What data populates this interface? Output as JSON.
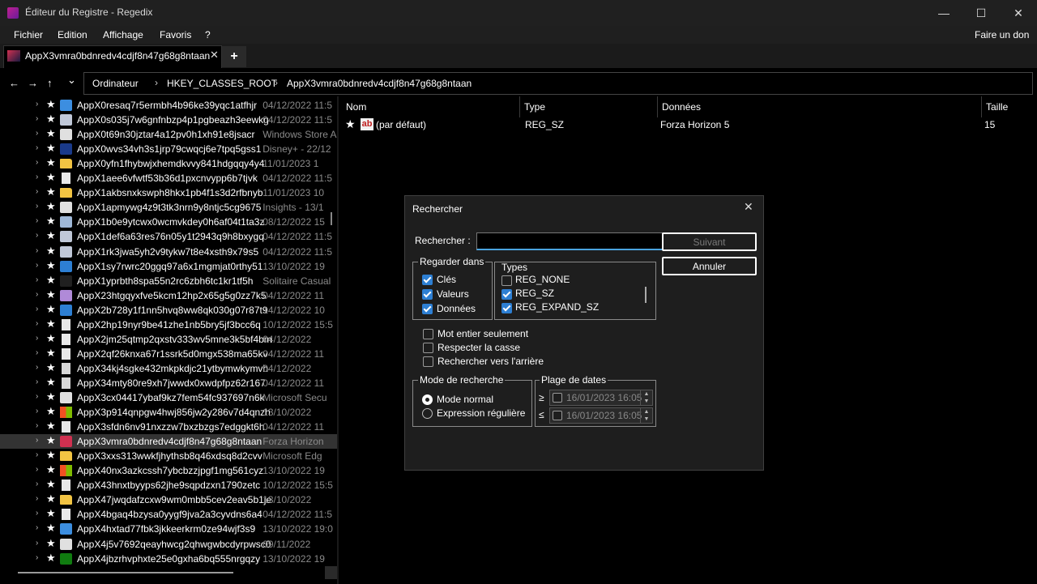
{
  "window": {
    "title": "Éditeur du Registre - Regedix",
    "controls": {
      "minimize": "—",
      "maximize": "☐",
      "close": "✕"
    }
  },
  "menu": {
    "items": [
      "Fichier",
      "Edition",
      "Affichage",
      "Favoris",
      "?"
    ],
    "right": "Faire un don"
  },
  "tabs": {
    "active_label": "AppX3vmra0bdnredv4cdjf8n47g68g8ntaan",
    "close": "✕",
    "add": "+"
  },
  "nav": {
    "back": "←",
    "forward": "→",
    "up": "↑",
    "history": "⌄",
    "breadcrumbs": [
      "Ordinateur",
      "HKEY_CLASSES_ROOT",
      "AppX3vmra0bdnredv4cdjf8n47g68g8ntaan"
    ],
    "separator": "›"
  },
  "tree": {
    "chevron": "›",
    "star": "★",
    "rows": [
      {
        "name": "AppX0resaq7r5ermbh4b96ke39yqc1atfhjr",
        "info": "04/12/2022 11:5",
        "icon": "people-icon",
        "color": "#3c8ee0"
      },
      {
        "name": "AppX0s035j7w6gnfnbzp4p1pgbeazh3eewkg",
        "info": "04/12/2022 11:5",
        "icon": "app-icon",
        "color": "#c0c8d8"
      },
      {
        "name": "AppX0t69n30jztar4a12pv0h1xh91e8jsacr",
        "info": "Windows Store A",
        "icon": "store-icon",
        "color": "#e0e0e0"
      },
      {
        "name": "AppX0wvs34vh3s1jrp79cwqcj6e7tpq5gss1",
        "info": "Disney+ - 22/12",
        "icon": "disney-icon",
        "color": "#1a3a8a"
      },
      {
        "name": "AppX0yfn1fhybwjxhemdkvvy841hdgqqy4y4",
        "info": "11/01/2023 1",
        "icon": "folder-icon",
        "color": "#f2c443"
      },
      {
        "name": "AppX1aee6vfwtf53b36d1pxcnvypp6b7tjvk",
        "info": "04/12/2022 11:5",
        "icon": "file-icon",
        "color": "#e8e8e8"
      },
      {
        "name": "AppX1akbsnxkswph8hkx1pb4f1s3d2rfbnyb",
        "info": "11/01/2023 10",
        "icon": "folder-icon",
        "color": "#f2c443"
      },
      {
        "name": "AppX1apmywg4z9t3tk3nrn9y8ntjc5cg9675",
        "info": "Insights - 13/1",
        "icon": "window-icon",
        "color": "#e0e0e0"
      },
      {
        "name": "AppX1b0e9ytcwx0wcmvkdey0h6af04t1ta3z",
        "info": "08/12/2022 15",
        "icon": "image-icon",
        "color": "#9fb8d8"
      },
      {
        "name": "AppX1def6a63res76n05y1t2943q9h8bxygq",
        "info": "04/12/2022 11:5",
        "icon": "app-icon",
        "color": "#c0c8d8"
      },
      {
        "name": "AppX1rk3jwa5yh2v9tykw7t8e4xsth9x79s5",
        "info": "04/12/2022 11:5",
        "icon": "app-icon",
        "color": "#c0c8d8"
      },
      {
        "name": "AppX1sy7rwrc20ggq97a6x1mgmjat0rthy51",
        "info": "13/10/2022 19",
        "icon": "shield-icon",
        "color": "#2d7fd3"
      },
      {
        "name": "AppX1yprbth8spa55n2rc6zbh6tc1kr1tf5h",
        "info": "Solitaire Casual",
        "icon": "cards-icon",
        "color": "#202020"
      },
      {
        "name": "AppX23htgqyxfve5kcm12hp2x65g5g0zz7k5",
        "info": "04/12/2022 11",
        "icon": "app-icon",
        "color": "#b08ad8"
      },
      {
        "name": "AppX2b728y1f1nn5hvq8ww8qk030g07r87t9",
        "info": "14/12/2022 10",
        "icon": "gear-icon",
        "color": "#2d7fd3"
      },
      {
        "name": "AppX2hp19nyr9be41zhe1nb5bry5jf3bcc6q",
        "info": "10/12/2022 15:5",
        "icon": "doc-icon",
        "color": "#e8e8e8"
      },
      {
        "name": "AppX2jm25qtmp2qxstv333wv5mne3k5bf4bm",
        "info": "04/12/2022",
        "icon": "file-icon",
        "color": "#e8e8e8"
      },
      {
        "name": "AppX2qf26knxa67r1ssrk5d0mgx538ma65kv",
        "info": "04/12/2022 11",
        "icon": "file-icon",
        "color": "#e8e8e8"
      },
      {
        "name": "AppX34kj4sgke432mkpkdjc21ytbymwkymvh",
        "info": "04/12/2022",
        "icon": "file-icon",
        "color": "#d8d8d8"
      },
      {
        "name": "AppX34mty80re9xh7jwwdx0xwdpfpz62r167",
        "info": "04/12/2022 11",
        "icon": "file-icon",
        "color": "#d8d8d8"
      },
      {
        "name": "AppX3cx04417ybaf9kz7fem54fc937697n6k",
        "info": "Microsoft Secu",
        "icon": "security-icon",
        "color": "#e0e0e0"
      },
      {
        "name": "AppX3p914qnpgw4hwj856jw2y286v7d4qnzh",
        "info": "13/10/2022",
        "icon": "windows-icon",
        "color": "#f25022"
      },
      {
        "name": "AppX3sfdn6nv91nxzzw7bxzbzgs7edggkt6h",
        "info": "04/12/2022 11",
        "icon": "file-icon",
        "color": "#e8e8e8"
      },
      {
        "name": "AppX3vmra0bdnredv4cdjf8n47g68g8ntaan",
        "info": "Forza Horizon",
        "icon": "forza-icon",
        "color": "#d03050",
        "selected": true
      },
      {
        "name": "AppX3xxs313wwkfjhythsb8q46xdsq8d2cvv",
        "info": "Microsoft Edg",
        "icon": "folder-icon",
        "color": "#f2c443"
      },
      {
        "name": "AppX40nx3azkcssh7ybcbzzjpgf1mg561cyz",
        "info": "13/10/2022 19",
        "icon": "windows-icon",
        "color": "#f25022"
      },
      {
        "name": "AppX43hnxtbyyps62jhe9sqpdzxn1790zetc",
        "info": "10/12/2022 15:5",
        "icon": "doc-icon",
        "color": "#e8e8e8"
      },
      {
        "name": "AppX47jwqdafzcxw9wm0mbb5cev2eav5b1je",
        "info": "13/10/2022",
        "icon": "folder-icon",
        "color": "#f2c443"
      },
      {
        "name": "AppX4bgaq4bzysa0yygf9jva2a3cyvdns6a4",
        "info": "04/12/2022 11:5",
        "icon": "file-icon",
        "color": "#e8e8e8"
      },
      {
        "name": "AppX4hxtad77fbk3jkkeerkrm0ze94wjf3s9",
        "info": "13/10/2022 19:0",
        "icon": "window-icon",
        "color": "#3c8ee0"
      },
      {
        "name": "AppX4j5v7692qeayhwcg2qhwgwbcdyrpwsc0",
        "info": "09/11/2022",
        "icon": "feed-icon",
        "color": "#e0e0e0"
      },
      {
        "name": "AppX4jbzrhvphxte25e0gxha6bq555nrgqzy",
        "info": "13/10/2022 19",
        "icon": "xbox-icon",
        "color": "#107c10"
      }
    ]
  },
  "list": {
    "columns": [
      "Nom",
      "Type",
      "Données",
      "Taille"
    ],
    "rows": [
      {
        "star": "★",
        "icon": "string-value-icon",
        "icon_text": "ab",
        "name": "(par défaut)",
        "type": "REG_SZ",
        "data": "Forza Horizon 5",
        "size": "15"
      }
    ]
  },
  "dialog": {
    "title": "Rechercher",
    "close": "✕",
    "search_label": "Rechercher :",
    "search_value": "",
    "btn_next": "Suivant",
    "btn_cancel": "Annuler",
    "look_in": {
      "legend": "Regarder dans",
      "options": [
        {
          "label": "Clés",
          "checked": true
        },
        {
          "label": "Valeurs",
          "checked": true
        },
        {
          "label": "Données",
          "checked": true
        }
      ]
    },
    "types": {
      "legend": "Types",
      "options": [
        {
          "label": "REG_NONE",
          "checked": false
        },
        {
          "label": "REG_SZ",
          "checked": true
        },
        {
          "label": "REG_EXPAND_SZ",
          "checked": true
        }
      ]
    },
    "flags": [
      {
        "label": "Mot entier seulement",
        "checked": false
      },
      {
        "label": "Respecter la casse",
        "checked": false
      },
      {
        "label": "Rechercher vers l'arrière",
        "checked": false
      }
    ],
    "mode": {
      "legend": "Mode de recherche",
      "options": [
        {
          "label": "Mode normal",
          "selected": true
        },
        {
          "label": "Expression régulière",
          "selected": false
        }
      ]
    },
    "dates": {
      "legend": "Plage de dates",
      "rows": [
        {
          "op": "≥",
          "value": "16/01/2023 16:05"
        },
        {
          "op": "≤",
          "value": "16/01/2023 16:05"
        }
      ],
      "spin_up": "▲",
      "spin_down": "▼"
    }
  }
}
